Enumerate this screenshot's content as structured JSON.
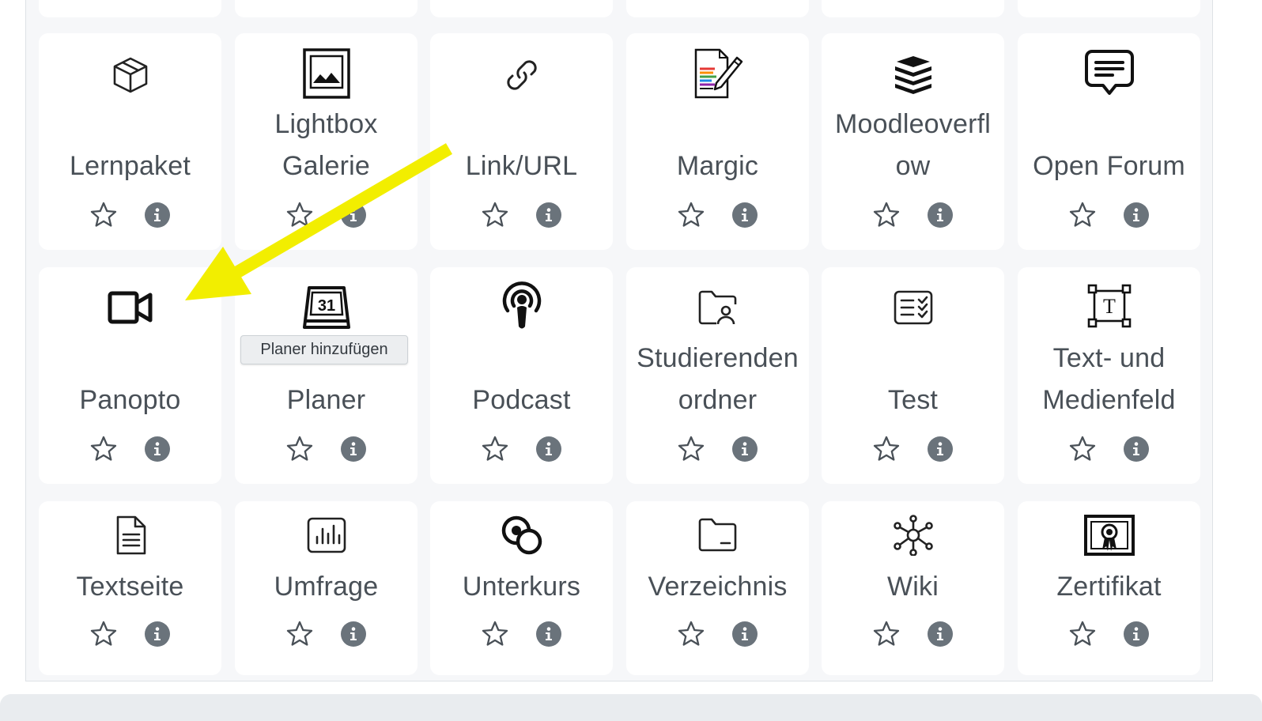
{
  "accent": {
    "arrow_color": "#f2ee00",
    "info_badge_color": "#6a737b"
  },
  "tooltip": {
    "text": "Planer hinzufügen"
  },
  "modules": [
    {
      "name": "Lernpaket",
      "icon": "package-box-icon"
    },
    {
      "name": "Lightbox Galerie",
      "icon": "image-gallery-icon"
    },
    {
      "name": "Link/URL",
      "icon": "link-icon"
    },
    {
      "name": "Margic",
      "icon": "colored-document-pen-icon"
    },
    {
      "name": "Moodleoverflow",
      "icon": "stacked-layers-icon"
    },
    {
      "name": "Open Forum",
      "icon": "chat-bubble-icon"
    },
    {
      "name": "Panopto",
      "icon": "video-camera-icon"
    },
    {
      "name": "Planer",
      "icon": "calendar-31-icon"
    },
    {
      "name": "Podcast",
      "icon": "podcast-icon"
    },
    {
      "name": "Studierendenordner",
      "icon": "student-folder-icon"
    },
    {
      "name": "Test",
      "icon": "checklist-icon"
    },
    {
      "name": "Text- und Medienfeld",
      "icon": "text-frame-icon"
    },
    {
      "name": "Textseite",
      "icon": "text-page-icon"
    },
    {
      "name": "Umfrage",
      "icon": "bar-chart-icon"
    },
    {
      "name": "Unterkurs",
      "icon": "subcourse-circles-icon"
    },
    {
      "name": "Verzeichnis",
      "icon": "folder-icon"
    },
    {
      "name": "Wiki",
      "icon": "network-icon"
    },
    {
      "name": "Zertifikat",
      "icon": "certificate-icon"
    }
  ],
  "display_lines": {
    "lightbox": [
      "Lightbox",
      "Galerie"
    ],
    "moodleoverflow": [
      "Moodleoverfl",
      "ow"
    ],
    "studierenden": [
      "Studierenden",
      "ordner"
    ],
    "textmedien": [
      "Text- und",
      "Medienfeld"
    ]
  }
}
